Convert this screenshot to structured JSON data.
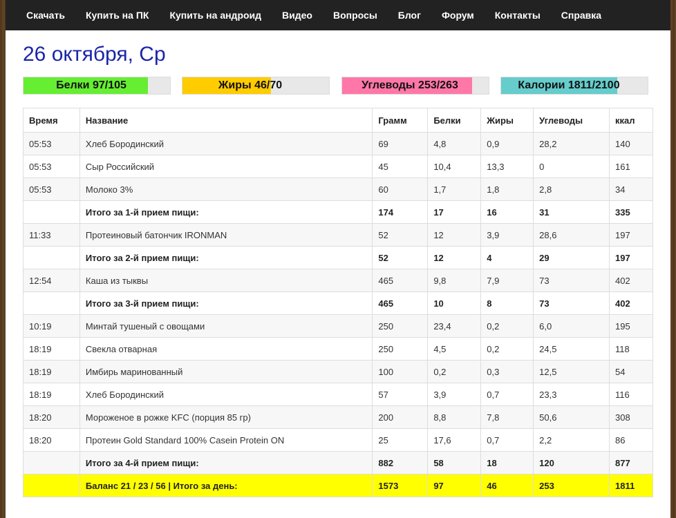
{
  "nav": [
    "Скачать",
    "Купить на ПК",
    "Купить на андроид",
    "Видео",
    "Вопросы",
    "Блог",
    "Форум",
    "Контакты",
    "Справка"
  ],
  "date_title": "26 октября, Ср",
  "progress": [
    {
      "label": "Белки 97/105",
      "fraction": 0.924,
      "color": "#66ee33"
    },
    {
      "label": "Жиры 46/70",
      "fraction": 0.657,
      "color": "#ffcc00"
    },
    {
      "label": "Углеводы 253/263",
      "fraction": 0.962,
      "color": "#ff77a8"
    },
    {
      "label": "Калории 1811/2100",
      "fraction": 0.862,
      "color": "#66cccc"
    }
  ],
  "table": {
    "headers": [
      "Время",
      "Название",
      "Грамм",
      "Белки",
      "Жиры",
      "Углеводы",
      "ккал"
    ],
    "rows": [
      {
        "type": "item",
        "cells": [
          "05:53",
          "Хлеб Бородинский",
          "69",
          "4,8",
          "0,9",
          "28,2",
          "140"
        ]
      },
      {
        "type": "item",
        "cells": [
          "05:53",
          "Сыр Российский",
          "45",
          "10,4",
          "13,3",
          "0",
          "161"
        ]
      },
      {
        "type": "item",
        "cells": [
          "05:53",
          "Молоко 3%",
          "60",
          "1,7",
          "1,8",
          "2,8",
          "34"
        ]
      },
      {
        "type": "subtotal",
        "cells": [
          "",
          "Итого за 1-й прием пищи:",
          "174",
          "17",
          "16",
          "31",
          "335"
        ]
      },
      {
        "type": "item",
        "cells": [
          "11:33",
          "Протеиновый батончик IRONMAN",
          "52",
          "12",
          "3,9",
          "28,6",
          "197"
        ]
      },
      {
        "type": "subtotal",
        "cells": [
          "",
          "Итого за 2-й прием пищи:",
          "52",
          "12",
          "4",
          "29",
          "197"
        ]
      },
      {
        "type": "item",
        "cells": [
          "12:54",
          "Каша из тыквы",
          "465",
          "9,8",
          "7,9",
          "73",
          "402"
        ]
      },
      {
        "type": "subtotal",
        "cells": [
          "",
          "Итого за 3-й прием пищи:",
          "465",
          "10",
          "8",
          "73",
          "402"
        ]
      },
      {
        "type": "item",
        "cells": [
          "10:19",
          "Минтай тушеный с овощами",
          "250",
          "23,4",
          "0,2",
          "6,0",
          "195"
        ]
      },
      {
        "type": "item",
        "cells": [
          "18:19",
          "Свекла отварная",
          "250",
          "4,5",
          "0,2",
          "24,5",
          "118"
        ]
      },
      {
        "type": "item",
        "cells": [
          "18:19",
          "Имбирь маринованный",
          "100",
          "0,2",
          "0,3",
          "12,5",
          "54"
        ]
      },
      {
        "type": "item",
        "cells": [
          "18:19",
          "Хлеб Бородинский",
          "57",
          "3,9",
          "0,7",
          "23,3",
          "116"
        ]
      },
      {
        "type": "item",
        "cells": [
          "18:20",
          "Мороженое в рожке KFC (порция 85 гр)",
          "200",
          "8,8",
          "7,8",
          "50,6",
          "308"
        ]
      },
      {
        "type": "item",
        "cells": [
          "18:20",
          "Протеин Gold Standard 100% Casein Protein ON",
          "25",
          "17,6",
          "0,7",
          "2,2",
          "86"
        ]
      },
      {
        "type": "subtotal",
        "cells": [
          "",
          "Итого за 4-й прием пищи:",
          "882",
          "58",
          "18",
          "120",
          "877"
        ]
      },
      {
        "type": "total",
        "cells": [
          "",
          "Баланс 21 / 23 / 56 | Итого за день:",
          "1573",
          "97",
          "46",
          "253",
          "1811"
        ]
      }
    ]
  }
}
